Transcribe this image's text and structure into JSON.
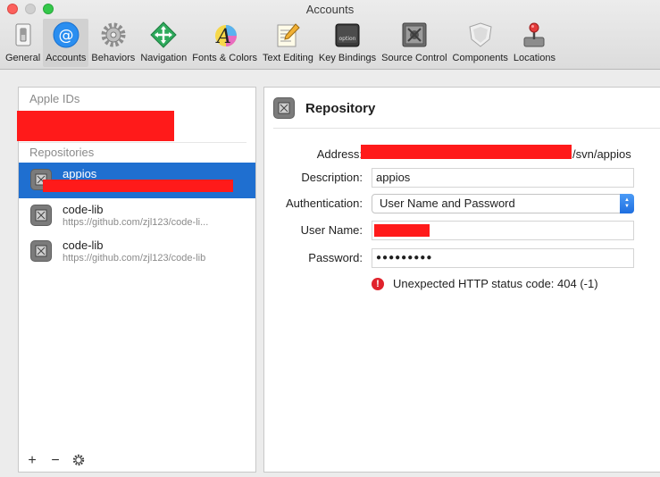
{
  "window": {
    "title": "Accounts"
  },
  "toolbar": {
    "items": [
      {
        "label": "General",
        "icon": "general-switch-icon"
      },
      {
        "label": "Accounts",
        "icon": "at-sign-icon",
        "active": true
      },
      {
        "label": "Behaviors",
        "icon": "gear-icon"
      },
      {
        "label": "Navigation",
        "icon": "navigation-arrows-icon"
      },
      {
        "label": "Fonts & Colors",
        "icon": "font-a-icon"
      },
      {
        "label": "Text Editing",
        "icon": "text-editing-icon"
      },
      {
        "label": "Key Bindings",
        "icon": "option-key-icon"
      },
      {
        "label": "Source Control",
        "icon": "source-control-icon"
      },
      {
        "label": "Components",
        "icon": "components-shield-icon"
      },
      {
        "label": "Locations",
        "icon": "locations-joystick-icon"
      }
    ]
  },
  "sidebar": {
    "apple_ids_header": "Apple IDs",
    "repositories_header": "Repositories",
    "repositories": [
      {
        "name": "appios",
        "url": "",
        "selected": true
      },
      {
        "name": "code-lib",
        "url": "https://github.com/zjl123/code-li..."
      },
      {
        "name": "code-lib",
        "url": "https://github.com/zjl123/code-lib"
      }
    ],
    "add_symbol": "+",
    "remove_symbol": "−",
    "settings_icon": "gear-icon"
  },
  "detail": {
    "title": "Repository",
    "address_label": "Address:",
    "address_value_suffix": "/svn/appios",
    "description_label": "Description:",
    "description_value": "appios",
    "authentication_label": "Authentication:",
    "authentication_value": "User Name and Password",
    "username_label": "User Name:",
    "password_label": "Password:",
    "password_value": "●●●●●●●●●",
    "error_icon": "!",
    "error_text": "Unexpected HTTP status code: 404 (-1)"
  },
  "colors": {
    "selection": "#1f6fd0",
    "redaction": "#ff1a1a",
    "error": "#e0222b"
  }
}
